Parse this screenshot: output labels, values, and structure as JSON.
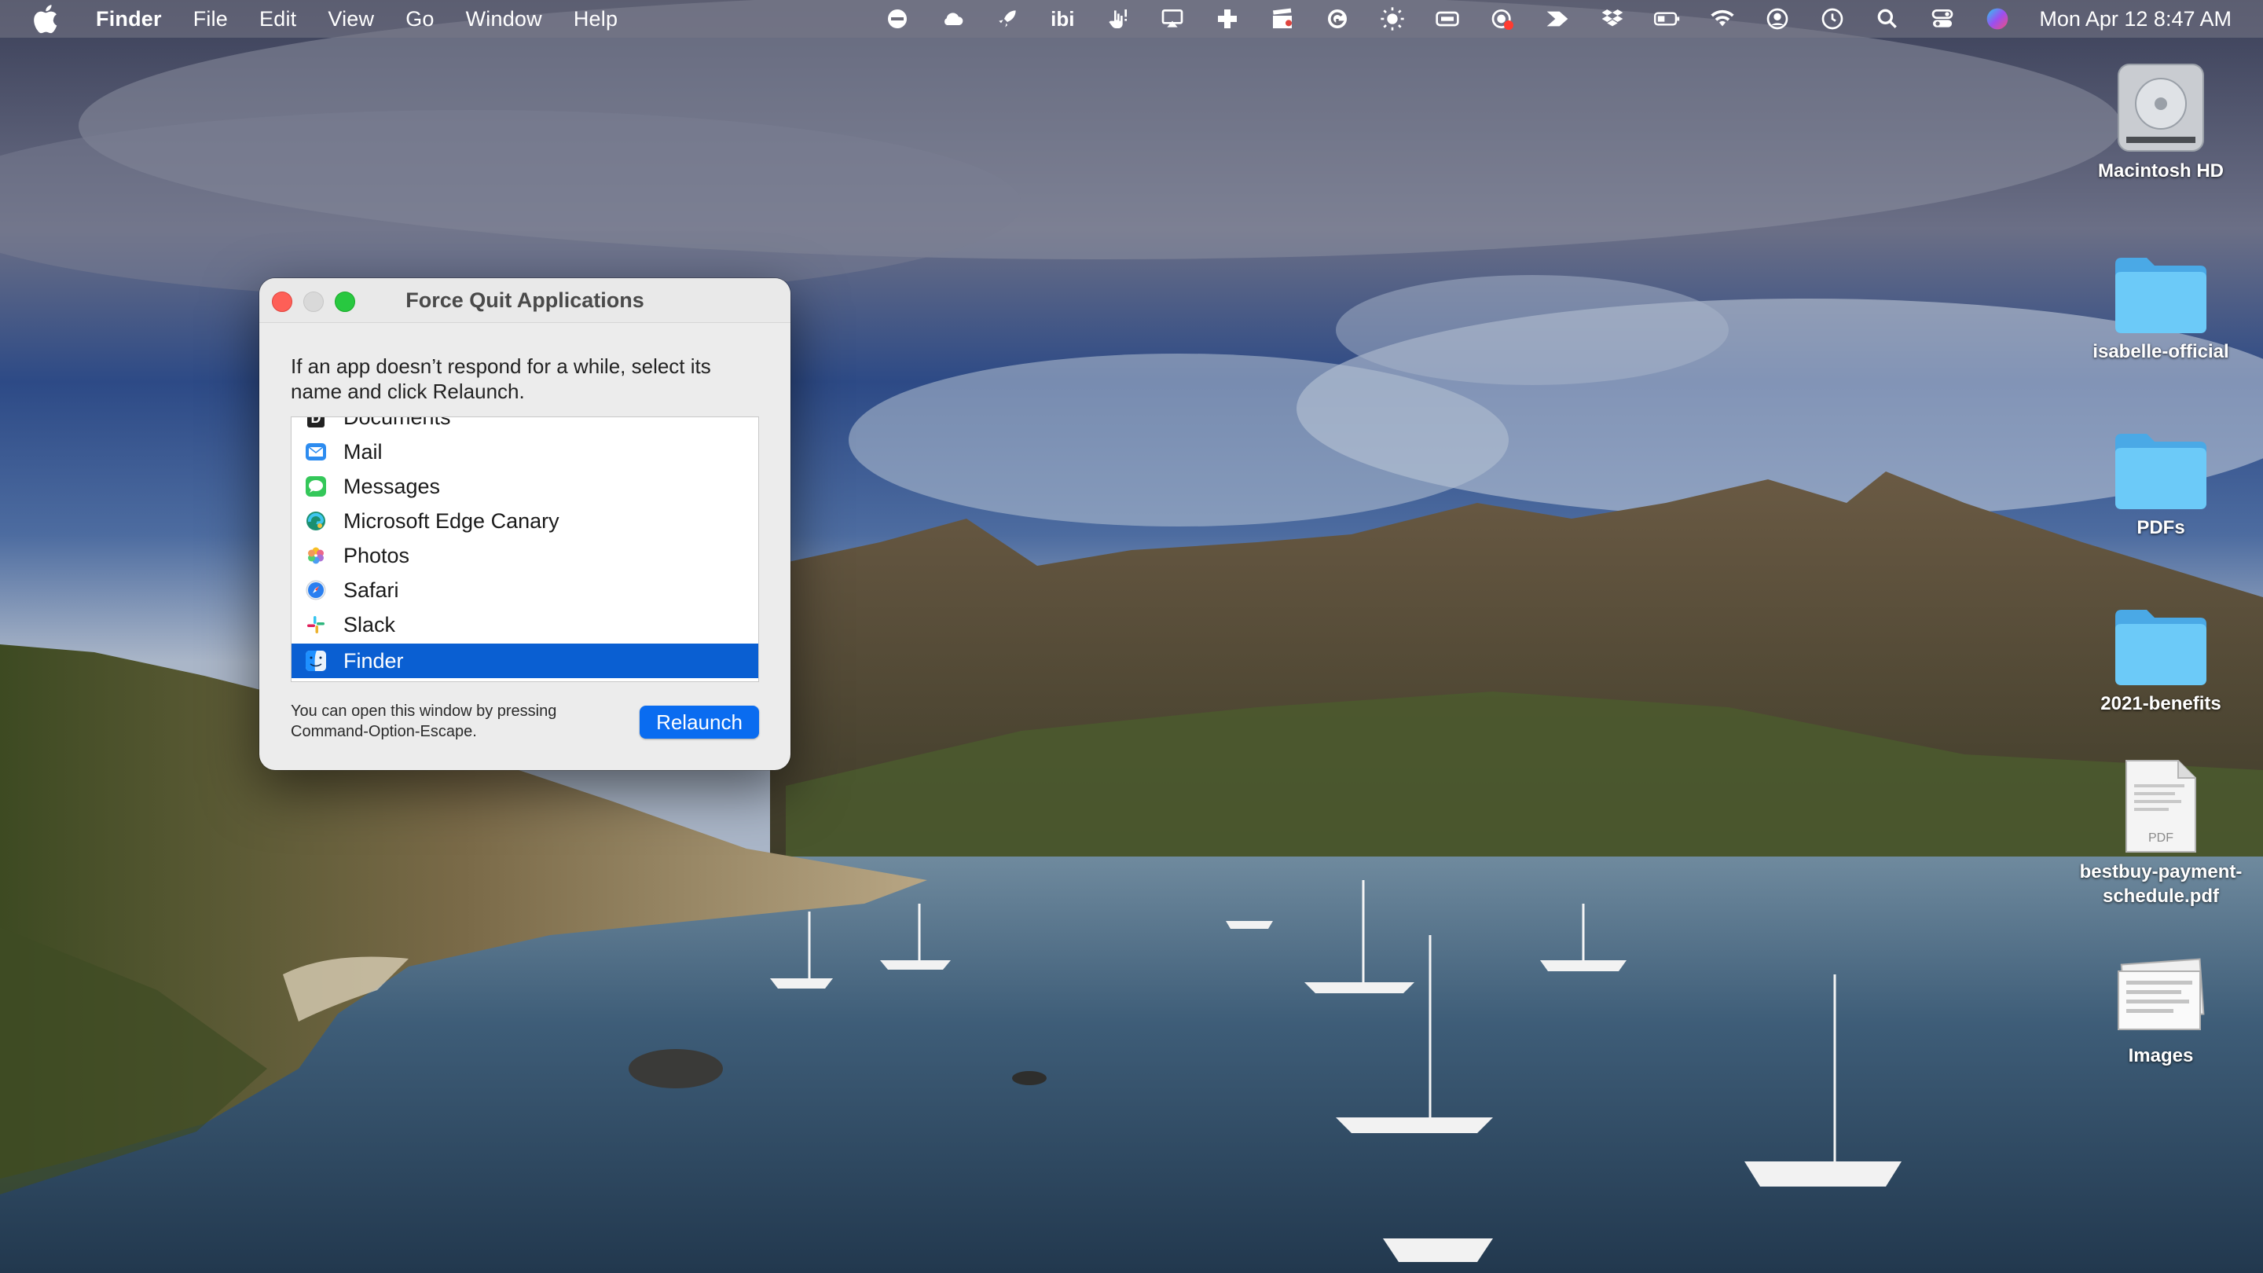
{
  "menubar": {
    "apple_icon": "apple-logo-icon",
    "app_name": "Finder",
    "menus": [
      "File",
      "Edit",
      "View",
      "Go",
      "Window",
      "Help"
    ],
    "status_icons": [
      "minus-circle-icon",
      "cloud-icon",
      "rocket-icon",
      "ibi-text-icon",
      "touch-alert-icon",
      "airplay-icon",
      "plus-cross-icon",
      "clapper-icon",
      "grammarly-icon",
      "brightness-icon",
      "dongle-icon",
      "record-icon",
      "arrow-forward-icon",
      "dropbox-icon",
      "battery-icon",
      "wifi-icon",
      "user-circle-icon",
      "time-machine-icon",
      "search-icon",
      "control-center-icon",
      "siri-icon"
    ],
    "ibi_text": "ibi",
    "clock": "Mon Apr 12  8:47 AM"
  },
  "desktop": {
    "icons": [
      {
        "label": "Macintosh HD",
        "icon": "hard-drive-icon"
      },
      {
        "label": "isabelle-official",
        "icon": "folder-icon"
      },
      {
        "label": "PDFs",
        "icon": "folder-icon"
      },
      {
        "label": "2021-benefits",
        "icon": "folder-icon"
      },
      {
        "label": "bestbuy-payment-schedule.pdf",
        "icon": "pdf-file-icon",
        "badge": "PDF"
      },
      {
        "label": "Images",
        "icon": "image-stack-icon"
      }
    ]
  },
  "force_quit": {
    "title": "Force Quit Applications",
    "instructions": "If an app doesn’t respond for a while, select its name and click Relaunch.",
    "apps": [
      {
        "name": "Documents",
        "icon": "documents-icon"
      },
      {
        "name": "Mail",
        "icon": "mail-icon"
      },
      {
        "name": "Messages",
        "icon": "messages-icon"
      },
      {
        "name": "Microsoft Edge Canary",
        "icon": "edge-canary-icon"
      },
      {
        "name": "Photos",
        "icon": "photos-icon"
      },
      {
        "name": "Safari",
        "icon": "safari-icon"
      },
      {
        "name": "Slack",
        "icon": "slack-icon"
      },
      {
        "name": "Finder",
        "icon": "finder-icon",
        "selected": true
      }
    ],
    "hint": "You can open this window by pressing Command-Option-Escape.",
    "button_label": "Relaunch"
  },
  "colors": {
    "selection": "#0a5fd2",
    "button": "#0a6cf0",
    "folder": "#5ac8fa",
    "close": "#fe5f57",
    "maximize": "#28c840"
  }
}
